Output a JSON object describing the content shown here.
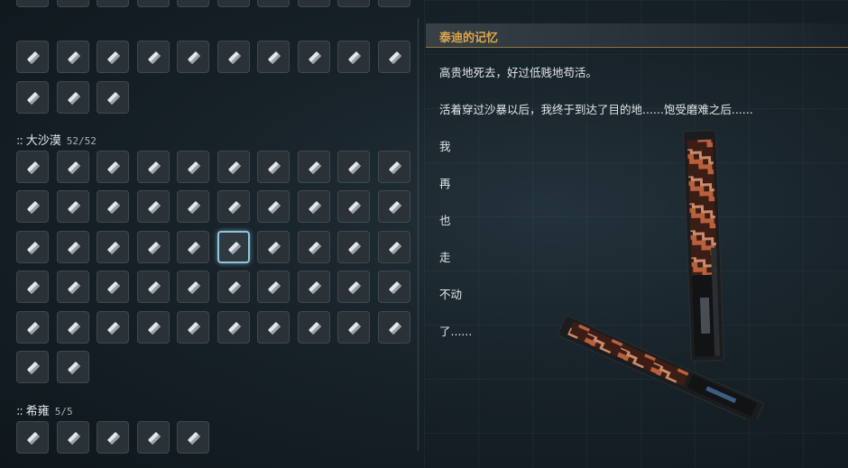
{
  "sections": [
    {
      "rows": [
        10,
        10,
        3
      ]
    },
    {
      "title": "大沙漠",
      "count": "52/52",
      "rows": [
        10,
        10,
        10,
        10,
        10,
        2
      ]
    },
    {
      "title": "希雍",
      "count": "5/5",
      "rows": [
        5
      ]
    }
  ],
  "selected": {
    "section": 1,
    "row": 2,
    "col": 5
  },
  "detail": {
    "title": "泰迪的记忆",
    "lines": [
      "高贵地死去，好过低贱地苟活。",
      "活着穿过沙暴以后，我终于到达了目的地......饱受磨难之后......",
      "我",
      "再",
      "也",
      "走",
      "不动",
      "了......"
    ]
  },
  "colors": {
    "accent": "#e0a64c",
    "selected_border": "#8fc6de"
  }
}
